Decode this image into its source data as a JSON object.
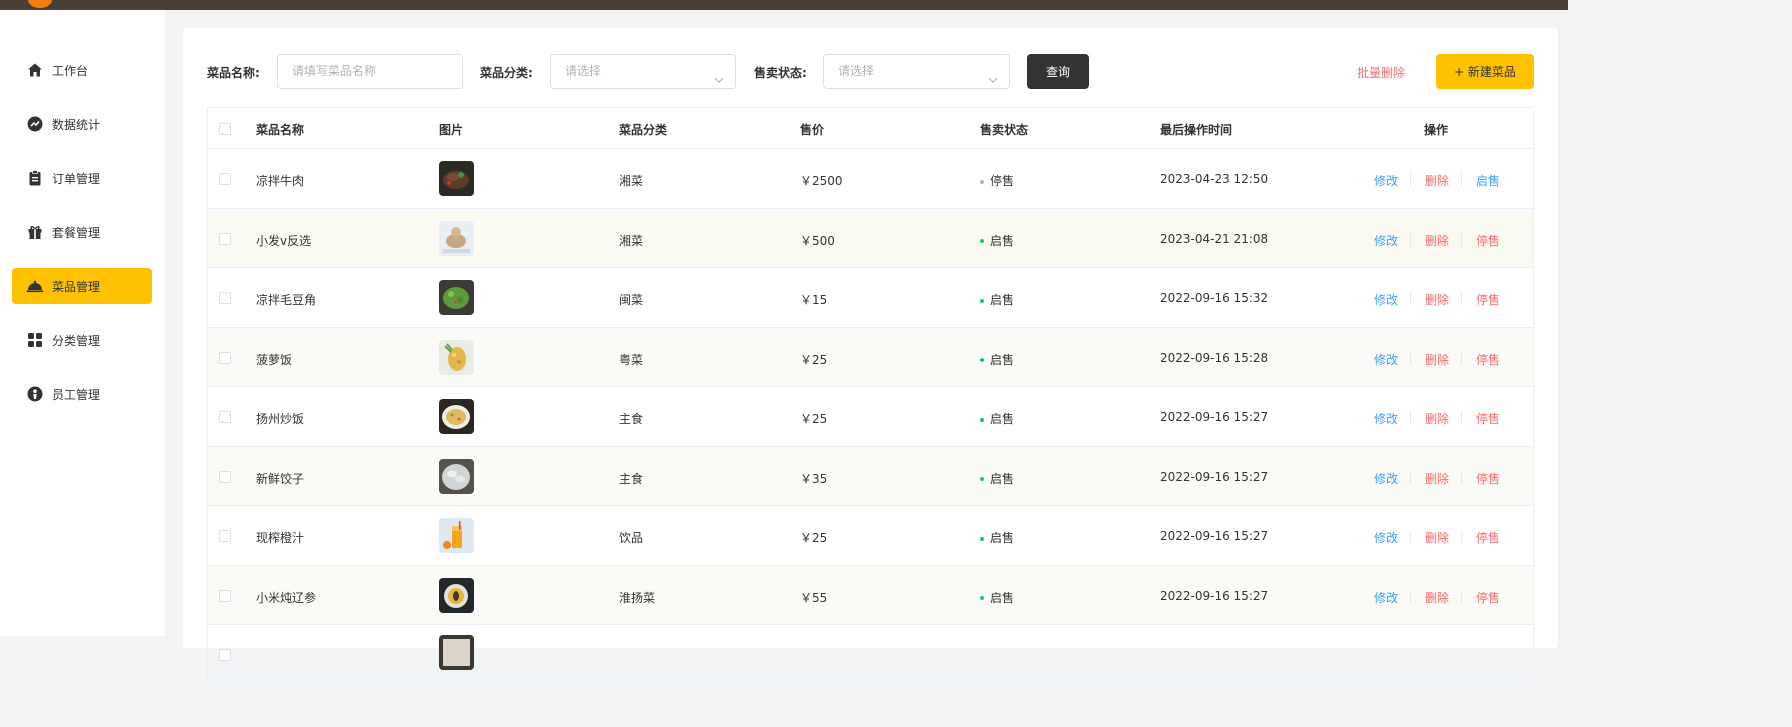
{
  "sidebar": {
    "items": [
      {
        "label": "工作台",
        "icon": "home-icon",
        "active": false
      },
      {
        "label": "数据统计",
        "icon": "chart-line-icon",
        "active": false
      },
      {
        "label": "订单管理",
        "icon": "clipboard-icon",
        "active": false
      },
      {
        "label": "套餐管理",
        "icon": "gift-icon",
        "active": false
      },
      {
        "label": "菜品管理",
        "icon": "dish-cover-icon",
        "active": true
      },
      {
        "label": "分类管理",
        "icon": "grid-icon",
        "active": false
      },
      {
        "label": "员工管理",
        "icon": "employee-icon",
        "active": false
      }
    ]
  },
  "filters": {
    "name_label": "菜品名称:",
    "name_placeholder": "请填写菜品名称",
    "category_label": "菜品分类:",
    "category_placeholder": "请选择",
    "status_label": "售卖状态:",
    "status_placeholder": "请选择",
    "query_label": "查询",
    "batch_delete_label": "批量删除",
    "new_label": "+ 新建菜品"
  },
  "table": {
    "headers": {
      "name": "菜品名称",
      "image": "图片",
      "category": "菜品分类",
      "price": "售价",
      "status": "售卖状态",
      "updated": "最后操作时间",
      "actions": "操作"
    },
    "rows": [
      {
        "name": "凉拌牛肉",
        "category": "湘菜",
        "price": "￥2500",
        "status": "停售",
        "updated": "2023-04-23 12:50",
        "edit": "修改",
        "delete": "删除",
        "toggle": "启售"
      },
      {
        "name": "小发v反选",
        "category": "湘菜",
        "price": "￥500",
        "status": "启售",
        "updated": "2023-04-21 21:08",
        "edit": "修改",
        "delete": "删除",
        "toggle": "停售"
      },
      {
        "name": "凉拌毛豆角",
        "category": "闽菜",
        "price": "￥15",
        "status": "启售",
        "updated": "2022-09-16 15:32",
        "edit": "修改",
        "delete": "删除",
        "toggle": "停售"
      },
      {
        "name": "菠萝饭",
        "category": "粤菜",
        "price": "￥25",
        "status": "启售",
        "updated": "2022-09-16 15:28",
        "edit": "修改",
        "delete": "删除",
        "toggle": "停售"
      },
      {
        "name": "扬州炒饭",
        "category": "主食",
        "price": "￥25",
        "status": "启售",
        "updated": "2022-09-16 15:27",
        "edit": "修改",
        "delete": "删除",
        "toggle": "停售"
      },
      {
        "name": "新鲜饺子",
        "category": "主食",
        "price": "￥35",
        "status": "启售",
        "updated": "2022-09-16 15:27",
        "edit": "修改",
        "delete": "删除",
        "toggle": "停售"
      },
      {
        "name": "现榨橙汁",
        "category": "饮品",
        "price": "￥25",
        "status": "启售",
        "updated": "2022-09-16 15:27",
        "edit": "修改",
        "delete": "删除",
        "toggle": "停售"
      },
      {
        "name": "小米炖辽参",
        "category": "淮扬菜",
        "price": "￥55",
        "status": "启售",
        "updated": "2022-09-16 15:27",
        "edit": "修改",
        "delete": "删除",
        "toggle": "停售"
      }
    ]
  },
  "colors": {
    "accent": "#ffc200",
    "danger": "#f56c6c",
    "link": "#419efb",
    "status_on": "#22c55e",
    "status_off": "#b0b3b8",
    "topbar": "#4a3f35"
  }
}
